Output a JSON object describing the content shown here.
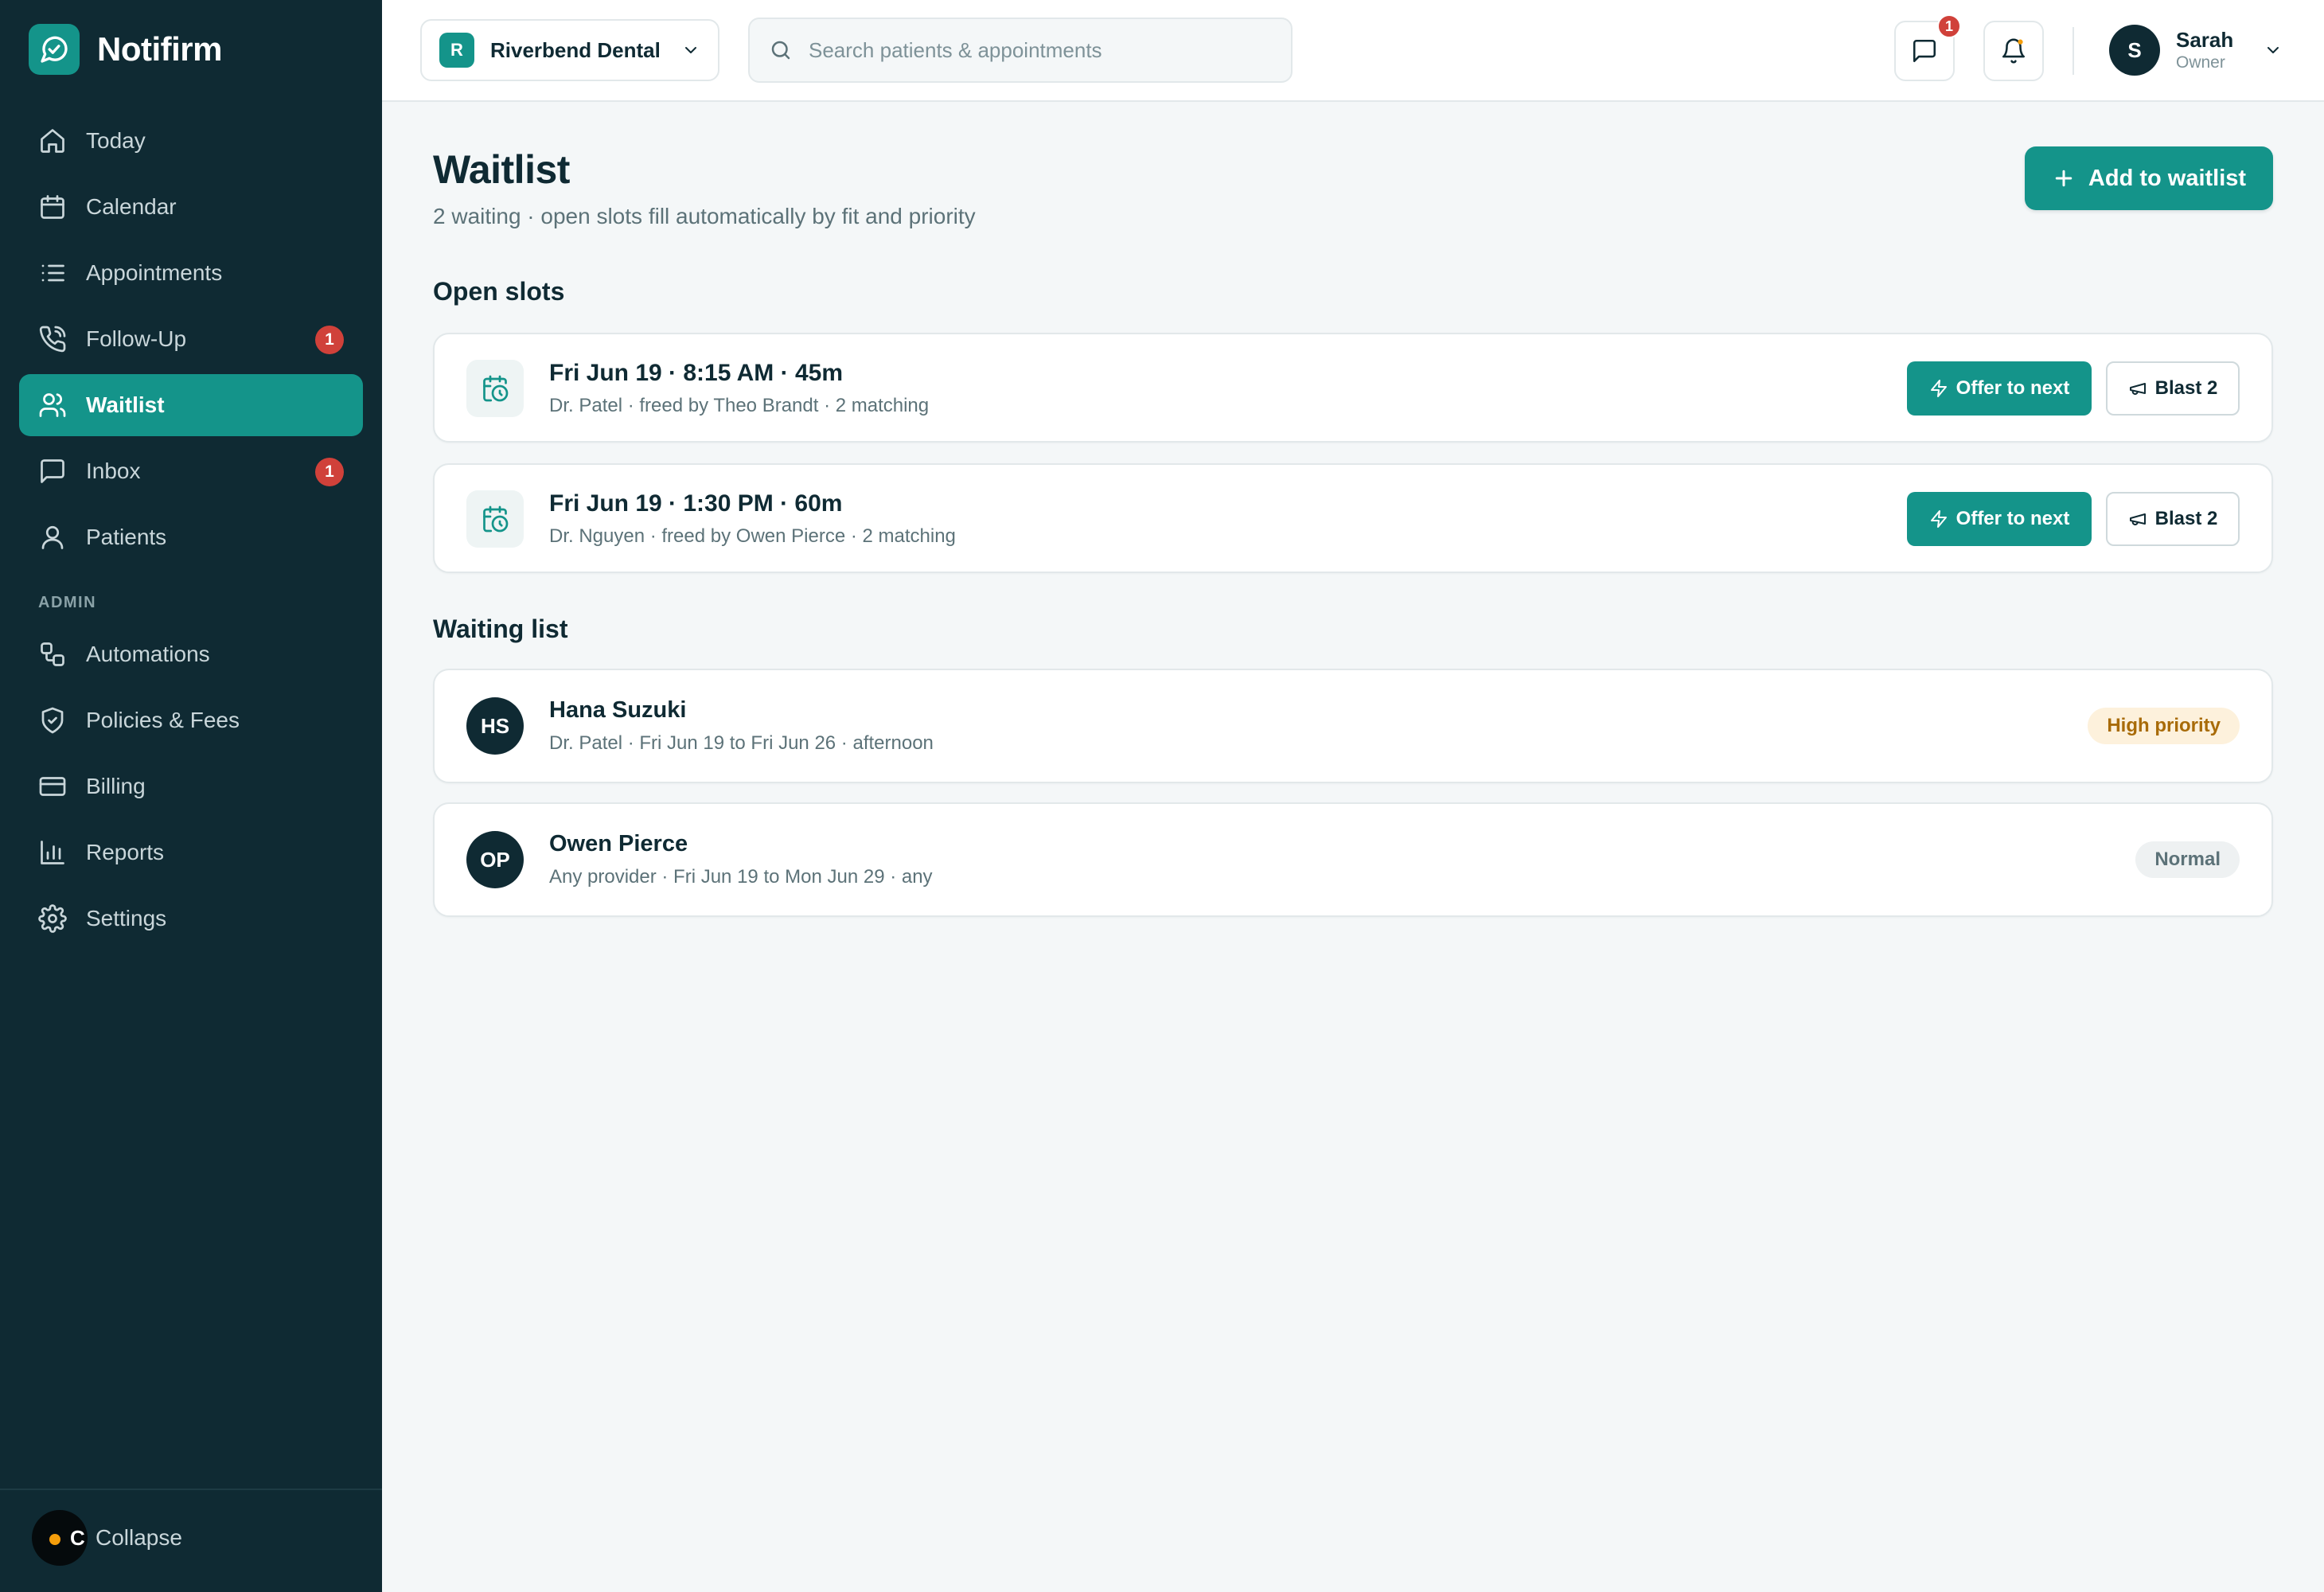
{
  "brand": {
    "name": "Notifirm"
  },
  "nav": {
    "items": [
      {
        "label": "Today",
        "icon": "home-icon"
      },
      {
        "label": "Calendar",
        "icon": "calendar-icon"
      },
      {
        "label": "Appointments",
        "icon": "list-icon"
      },
      {
        "label": "Follow-Up",
        "icon": "phone-icon",
        "badge": "1"
      },
      {
        "label": "Waitlist",
        "icon": "users-icon",
        "active": true
      },
      {
        "label": "Inbox",
        "icon": "message-icon",
        "badge": "1"
      },
      {
        "label": "Patients",
        "icon": "user-icon"
      }
    ],
    "admin_label": "ADMIN",
    "admin_items": [
      {
        "label": "Automations",
        "icon": "workflow-icon"
      },
      {
        "label": "Policies & Fees",
        "icon": "shield-icon"
      },
      {
        "label": "Billing",
        "icon": "credit-card-icon"
      },
      {
        "label": "Reports",
        "icon": "bar-chart-icon"
      },
      {
        "label": "Settings",
        "icon": "gear-icon"
      }
    ],
    "collapse_label": "Collapse",
    "collapse_letter": "C"
  },
  "topbar": {
    "practice_initial": "R",
    "practice_name": "Riverbend Dental",
    "search_placeholder": "Search patients & appointments",
    "messages_badge": "1",
    "user_initial": "S",
    "user_name": "Sarah",
    "user_role": "Owner"
  },
  "page": {
    "title": "Waitlist",
    "subtitle": "2 waiting · open slots fill automatically by fit and priority",
    "add_button": "Add to waitlist",
    "open_slots_title": "Open slots",
    "waiting_list_title": "Waiting list"
  },
  "open_slots": [
    {
      "title": "Fri Jun 19 · 8:15 AM · 45m",
      "meta": "Dr. Patel · freed by Theo Brandt · 2 matching",
      "offer_label": "Offer to next",
      "blast_label": "Blast 2"
    },
    {
      "title": "Fri Jun 19 · 1:30 PM · 60m",
      "meta": "Dr. Nguyen · freed by Owen Pierce · 2 matching",
      "offer_label": "Offer to next",
      "blast_label": "Blast 2"
    }
  ],
  "waiting_list": [
    {
      "initials": "HS",
      "name": "Hana Suzuki",
      "meta": "Dr. Patel · Fri Jun 19 to Fri Jun 26 · afternoon",
      "priority": "High priority",
      "priority_level": "high"
    },
    {
      "initials": "OP",
      "name": "Owen Pierce",
      "meta": "Any provider · Fri Jun 19 to Mon Jun 29 · any",
      "priority": "Normal",
      "priority_level": "normal"
    }
  ],
  "colors": {
    "sidebar_bg": "#0f2a33",
    "accent": "#14948a",
    "badge_red": "#d0413a",
    "high_priority_bg": "#fdf1dc",
    "high_priority_text": "#a86b08"
  }
}
